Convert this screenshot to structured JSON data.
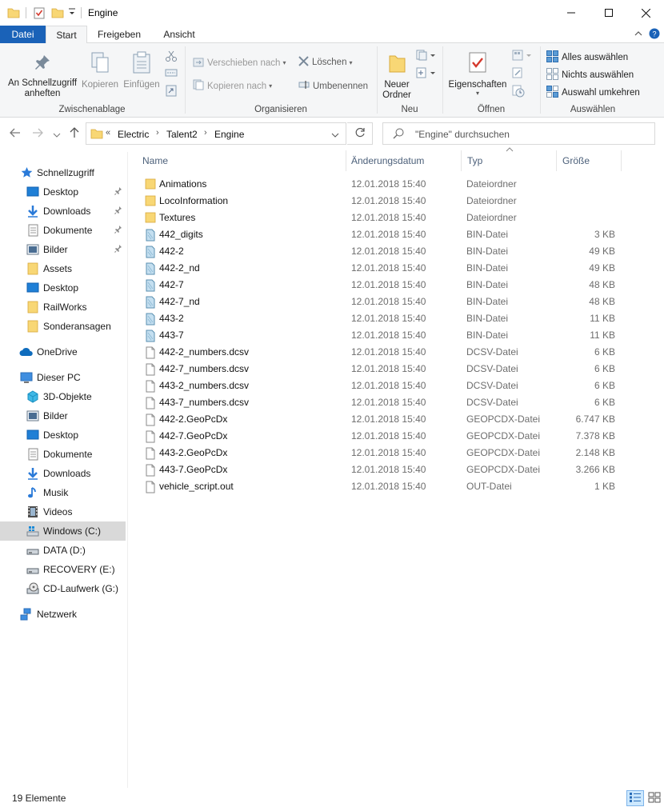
{
  "window": {
    "title": "Engine",
    "controls": {
      "minimize": "—",
      "maximize": "☐",
      "close": "✕"
    }
  },
  "ribbon_tabs": {
    "file": "Datei",
    "start": "Start",
    "share": "Freigeben",
    "view": "Ansicht"
  },
  "ribbon": {
    "clipboard": {
      "pin": "An Schnellzugriff anheften",
      "copy": "Kopieren",
      "paste": "Einfügen",
      "label": "Zwischenablage"
    },
    "organize": {
      "move": "Verschieben nach",
      "copy_to": "Kopieren nach",
      "delete": "Löschen",
      "rename": "Umbenennen",
      "label": "Organisieren"
    },
    "new": {
      "new_folder": "Neuer Ordner",
      "label": "Neu"
    },
    "open": {
      "properties": "Eigenschaften",
      "label": "Öffnen"
    },
    "select": {
      "select_all": "Alles auswählen",
      "select_none": "Nichts auswählen",
      "invert": "Auswahl umkehren",
      "label": "Auswählen"
    }
  },
  "address": {
    "overflow": "«",
    "crumbs": [
      "Electric",
      "Talent2",
      "Engine"
    ],
    "search_placeholder": "\"Engine\" durchsuchen"
  },
  "nav_pane": {
    "quick_access": "Schnellzugriff",
    "quick_items": [
      "Desktop",
      "Downloads",
      "Dokumente",
      "Bilder",
      "Assets",
      "Desktop",
      "RailWorks",
      "Sonderansagen"
    ],
    "onedrive": "OneDrive",
    "this_pc": "Dieser PC",
    "pc_items": [
      "3D-Objekte",
      "Bilder",
      "Desktop",
      "Dokumente",
      "Downloads",
      "Musik",
      "Videos",
      "Windows (C:)",
      "DATA (D:)",
      "RECOVERY (E:)",
      "CD-Laufwerk (G:)"
    ],
    "network": "Netzwerk"
  },
  "columns": {
    "name": "Name",
    "date": "Änderungsdatum",
    "type": "Typ",
    "size": "Größe"
  },
  "files": [
    {
      "name": "Animations",
      "date": "12.01.2018 15:40",
      "type": "Dateiordner",
      "size": "",
      "kind": "folder"
    },
    {
      "name": "LocoInformation",
      "date": "12.01.2018 15:40",
      "type": "Dateiordner",
      "size": "",
      "kind": "folder"
    },
    {
      "name": "Textures",
      "date": "12.01.2018 15:40",
      "type": "Dateiordner",
      "size": "",
      "kind": "folder"
    },
    {
      "name": "442_digits",
      "date": "12.01.2018 15:40",
      "type": "BIN-Datei",
      "size": "3 KB",
      "kind": "bin"
    },
    {
      "name": "442-2",
      "date": "12.01.2018 15:40",
      "type": "BIN-Datei",
      "size": "49 KB",
      "kind": "bin"
    },
    {
      "name": "442-2_nd",
      "date": "12.01.2018 15:40",
      "type": "BIN-Datei",
      "size": "49 KB",
      "kind": "bin"
    },
    {
      "name": "442-7",
      "date": "12.01.2018 15:40",
      "type": "BIN-Datei",
      "size": "48 KB",
      "kind": "bin"
    },
    {
      "name": "442-7_nd",
      "date": "12.01.2018 15:40",
      "type": "BIN-Datei",
      "size": "48 KB",
      "kind": "bin"
    },
    {
      "name": "443-2",
      "date": "12.01.2018 15:40",
      "type": "BIN-Datei",
      "size": "11 KB",
      "kind": "bin"
    },
    {
      "name": "443-7",
      "date": "12.01.2018 15:40",
      "type": "BIN-Datei",
      "size": "11 KB",
      "kind": "bin"
    },
    {
      "name": "442-2_numbers.dcsv",
      "date": "12.01.2018 15:40",
      "type": "DCSV-Datei",
      "size": "6 KB",
      "kind": "doc"
    },
    {
      "name": "442-7_numbers.dcsv",
      "date": "12.01.2018 15:40",
      "type": "DCSV-Datei",
      "size": "6 KB",
      "kind": "doc"
    },
    {
      "name": "443-2_numbers.dcsv",
      "date": "12.01.2018 15:40",
      "type": "DCSV-Datei",
      "size": "6 KB",
      "kind": "doc"
    },
    {
      "name": "443-7_numbers.dcsv",
      "date": "12.01.2018 15:40",
      "type": "DCSV-Datei",
      "size": "6 KB",
      "kind": "doc"
    },
    {
      "name": "442-2.GeoPcDx",
      "date": "12.01.2018 15:40",
      "type": "GEOPCDX-Datei",
      "size": "6.747 KB",
      "kind": "doc"
    },
    {
      "name": "442-7.GeoPcDx",
      "date": "12.01.2018 15:40",
      "type": "GEOPCDX-Datei",
      "size": "7.378 KB",
      "kind": "doc"
    },
    {
      "name": "443-2.GeoPcDx",
      "date": "12.01.2018 15:40",
      "type": "GEOPCDX-Datei",
      "size": "2.148 KB",
      "kind": "doc"
    },
    {
      "name": "443-7.GeoPcDx",
      "date": "12.01.2018 15:40",
      "type": "GEOPCDX-Datei",
      "size": "3.266 KB",
      "kind": "doc"
    },
    {
      "name": "vehicle_script.out",
      "date": "12.01.2018 15:40",
      "type": "OUT-Datei",
      "size": "1 KB",
      "kind": "doc"
    }
  ],
  "status": {
    "count": "19 Elemente"
  },
  "colors": {
    "accent": "#1a62b8",
    "folder": "#f8d775",
    "selection": "#d9d9d9",
    "header_text": "#4c607a"
  }
}
